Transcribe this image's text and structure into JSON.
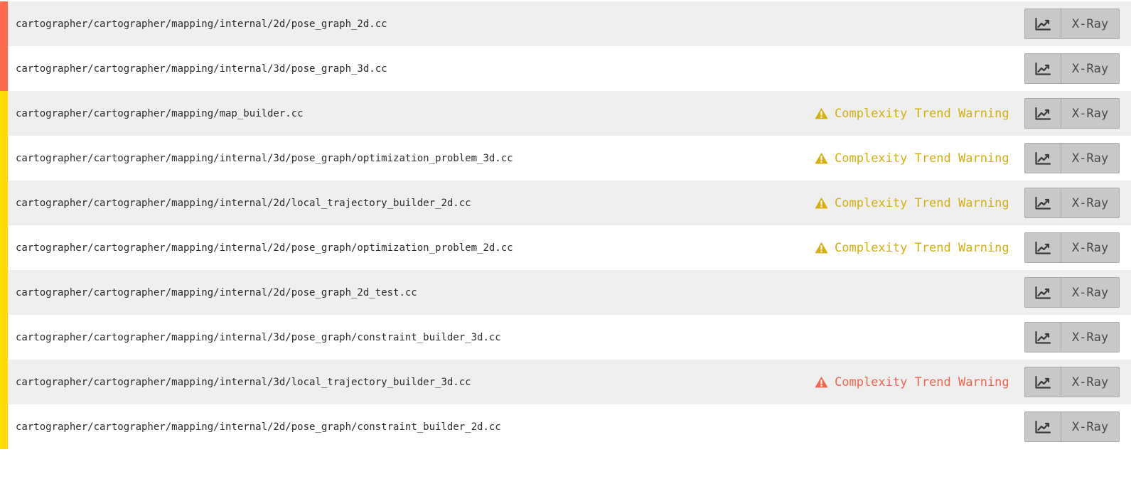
{
  "colors": {
    "bar_red": "#ff6b4a",
    "bar_yellow": "#ffd900",
    "warning_yellow": "#d4af0e",
    "warning_red": "#f2644b"
  },
  "icons": {
    "warning": "warning-triangle-icon",
    "trend": "line-chart-icon"
  },
  "rows": [
    {
      "path": "cartographer/cartographer/mapping/internal/2d/pose_graph_2d.cc",
      "bar": "red",
      "warning": null,
      "xray_label": "X-Ray"
    },
    {
      "path": "cartographer/cartographer/mapping/internal/3d/pose_graph_3d.cc",
      "bar": "red",
      "warning": null,
      "xray_label": "X-Ray"
    },
    {
      "path": "cartographer/cartographer/mapping/map_builder.cc",
      "bar": "yellow",
      "warning": {
        "label": "Complexity Trend Warning",
        "level": "yellow"
      },
      "xray_label": "X-Ray"
    },
    {
      "path": "cartographer/cartographer/mapping/internal/3d/pose_graph/optimization_problem_3d.cc",
      "bar": "yellow",
      "warning": {
        "label": "Complexity Trend Warning",
        "level": "yellow"
      },
      "xray_label": "X-Ray"
    },
    {
      "path": "cartographer/cartographer/mapping/internal/2d/local_trajectory_builder_2d.cc",
      "bar": "yellow",
      "warning": {
        "label": "Complexity Trend Warning",
        "level": "yellow"
      },
      "xray_label": "X-Ray"
    },
    {
      "path": "cartographer/cartographer/mapping/internal/2d/pose_graph/optimization_problem_2d.cc",
      "bar": "yellow",
      "warning": {
        "label": "Complexity Trend Warning",
        "level": "yellow"
      },
      "xray_label": "X-Ray"
    },
    {
      "path": "cartographer/cartographer/mapping/internal/2d/pose_graph_2d_test.cc",
      "bar": "yellow",
      "warning": null,
      "xray_label": "X-Ray"
    },
    {
      "path": "cartographer/cartographer/mapping/internal/3d/pose_graph/constraint_builder_3d.cc",
      "bar": "yellow",
      "warning": null,
      "xray_label": "X-Ray"
    },
    {
      "path": "cartographer/cartographer/mapping/internal/3d/local_trajectory_builder_3d.cc",
      "bar": "yellow",
      "warning": {
        "label": "Complexity Trend Warning",
        "level": "red"
      },
      "xray_label": "X-Ray"
    },
    {
      "path": "cartographer/cartographer/mapping/internal/2d/pose_graph/constraint_builder_2d.cc",
      "bar": "yellow",
      "warning": null,
      "xray_label": "X-Ray"
    }
  ]
}
